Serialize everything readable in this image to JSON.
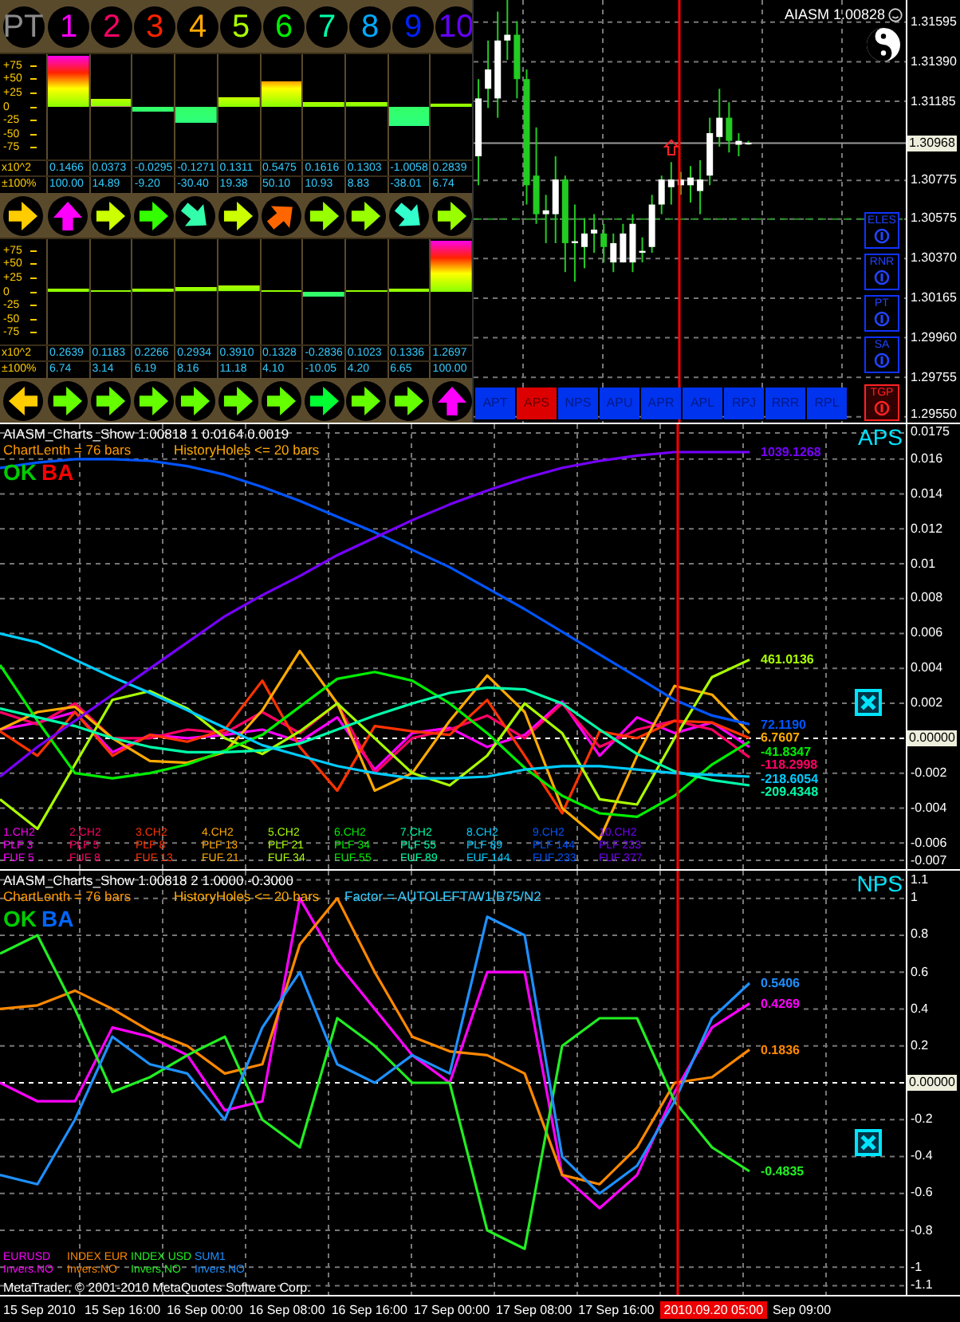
{
  "indicator_panel": {
    "header": [
      "PT",
      "1",
      "2",
      "3",
      "4",
      "5",
      "6",
      "7",
      "8",
      "9",
      "10"
    ],
    "blocks": [
      {
        "scale": [
          "+75",
          "+50",
          "+25",
          "0",
          "-25",
          "-50",
          "-75"
        ],
        "bars": [
          {
            "level": 1,
            "below_zero": false
          },
          {
            "level": 0.149,
            "below_zero": false
          },
          {
            "level": 0.092,
            "below_zero": true
          },
          {
            "level": 0.304,
            "below_zero": true
          },
          {
            "level": 0.194,
            "below_zero": false
          },
          {
            "level": 0.501,
            "below_zero": false
          },
          {
            "level": 0.109,
            "below_zero": false
          },
          {
            "level": 0.088,
            "below_zero": false
          },
          {
            "level": 0.38,
            "below_zero": true
          },
          {
            "level": 0.067,
            "below_zero": false
          }
        ],
        "value_row": {
          "label": "x10^2",
          "values": [
            "0.1466",
            "0.0373",
            "-0.0295",
            "-0.1271",
            "0.1311",
            "0.5475",
            "0.1616",
            "0.1303",
            "-1.0058",
            "0.2839"
          ]
        },
        "percent_row": {
          "label": "±100%",
          "values": [
            "100.00",
            "14.89",
            "-9.20",
            "-30.40",
            "19.38",
            "50.10",
            "10.93",
            "8.83",
            "-38.01",
            "6.74"
          ]
        },
        "arrows": [
          {
            "kind": "right",
            "color": "#ffcc00"
          },
          {
            "kind": "up",
            "color": "#ff00ff"
          },
          {
            "kind": "right",
            "color": "#ccff00"
          },
          {
            "kind": "right",
            "color": "#33ff00"
          },
          {
            "kind": "downright",
            "color": "#33ffaa"
          },
          {
            "kind": "right",
            "color": "#ccff00"
          },
          {
            "kind": "upright",
            "color": "#ff6600"
          },
          {
            "kind": "right",
            "color": "#99ff00"
          },
          {
            "kind": "right",
            "color": "#99ff00"
          },
          {
            "kind": "downright",
            "color": "#33ffcc"
          },
          {
            "kind": "right",
            "color": "#99ff00"
          }
        ]
      },
      {
        "scale": [
          "+75",
          "+50",
          "+25",
          "0",
          "-25",
          "-50",
          "-75"
        ],
        "bars": [
          {
            "level": 0.067,
            "below_zero": false
          },
          {
            "level": 0.031,
            "below_zero": false
          },
          {
            "level": 0.062,
            "below_zero": false
          },
          {
            "level": 0.082,
            "below_zero": false
          },
          {
            "level": 0.112,
            "below_zero": false
          },
          {
            "level": 0.041,
            "below_zero": false
          },
          {
            "level": 0.1,
            "below_zero": true
          },
          {
            "level": 0.042,
            "below_zero": false
          },
          {
            "level": 0.067,
            "below_zero": false
          },
          {
            "level": 1,
            "below_zero": false
          }
        ],
        "value_row": {
          "label": "x10^2",
          "values": [
            "0.2639",
            "0.1183",
            "0.2266",
            "0.2934",
            "0.3910",
            "0.1328",
            "-0.2836",
            "0.1023",
            "0.1336",
            "1.2697"
          ]
        },
        "percent_row": {
          "label": "±100%",
          "values": [
            "6.74",
            "3.14",
            "6.19",
            "8.16",
            "11.18",
            "4.10",
            "-10.05",
            "4.20",
            "6.65",
            "100.00"
          ]
        },
        "arrows": [
          {
            "kind": "left",
            "color": "#ffcc00"
          },
          {
            "kind": "right",
            "color": "#66ff00"
          },
          {
            "kind": "right",
            "color": "#66ff00"
          },
          {
            "kind": "right",
            "color": "#66ff00"
          },
          {
            "kind": "right",
            "color": "#66ff00"
          },
          {
            "kind": "right",
            "color": "#66ff00"
          },
          {
            "kind": "right",
            "color": "#66ff00"
          },
          {
            "kind": "right",
            "color": "#00ff33"
          },
          {
            "kind": "right",
            "color": "#66ff00"
          },
          {
            "kind": "right",
            "color": "#66ff00"
          },
          {
            "kind": "up",
            "color": "#ff00ff"
          }
        ]
      }
    ]
  },
  "price_chart": {
    "title": "AIASM 1.00828",
    "chart_data": {
      "type": "candlestick",
      "categories": [
        null,
        null,
        null,
        null,
        null,
        null,
        null,
        null,
        null,
        null,
        null,
        null,
        null,
        null,
        null,
        null,
        null,
        null,
        null,
        null,
        null,
        null,
        null,
        null,
        null,
        null,
        null,
        null,
        null,
        null,
        null,
        null,
        null,
        null,
        null,
        null,
        null,
        null,
        null,
        null,
        null,
        null,
        null,
        null,
        null
      ],
      "ylim": [
        1.2952,
        1.3171
      ],
      "yticks": [
        1.31595,
        {
          "value": 1.3139,
          "label": "1.31390"
        },
        1.31185,
        1.30775,
        1.30575,
        {
          "value": 1.3037,
          "label": "1.30370"
        },
        1.30165,
        {
          "value": 1.2996,
          "label": "1.29960"
        },
        1.29755,
        {
          "value": 1.2955,
          "label": "1.29550"
        }
      ],
      "ohlc": [
        [
          1.309,
          1.313,
          1.3075,
          1.312
        ],
        [
          1.3125,
          1.315,
          1.3115,
          1.3135
        ],
        [
          1.312,
          1.3165,
          1.311,
          1.315
        ],
        [
          1.315,
          1.3175,
          1.314,
          1.3153
        ],
        [
          1.3153,
          1.316,
          1.312,
          1.313
        ],
        [
          1.313,
          1.3135,
          1.3065,
          1.3075
        ],
        [
          1.308,
          1.3105,
          1.3055,
          1.306
        ],
        [
          1.306,
          1.307,
          1.3045,
          1.3062
        ],
        [
          1.306,
          1.309,
          1.3045,
          1.3078
        ],
        [
          1.3078,
          1.308,
          1.303,
          1.3045
        ],
        [
          1.3045,
          1.3065,
          1.3025,
          1.3046
        ],
        [
          1.3043,
          1.3058,
          1.3032,
          1.305
        ],
        [
          1.305,
          1.306,
          1.304,
          1.3052
        ],
        [
          1.305,
          1.3055,
          1.3035,
          1.3043
        ],
        [
          1.3035,
          1.305,
          1.303,
          1.3045
        ],
        [
          1.3035,
          1.3055,
          1.3035,
          1.305
        ],
        [
          1.3035,
          1.306,
          1.303,
          1.3055
        ],
        [
          1.304,
          1.3048,
          1.3035,
          1.3041
        ],
        [
          1.3043,
          1.307,
          1.304,
          1.3065
        ],
        [
          1.3065,
          1.308,
          1.306,
          1.3078
        ],
        [
          1.3074,
          1.3087,
          1.3065,
          1.3078
        ],
        [
          1.3075,
          1.3082,
          1.307,
          1.3078
        ],
        [
          1.3075,
          1.3085,
          1.3066,
          1.3079
        ],
        [
          1.3072,
          1.3088,
          1.306,
          1.3078
        ],
        [
          1.308,
          1.311,
          1.3075,
          1.3102
        ],
        [
          1.31,
          1.3125,
          1.3095,
          1.311
        ],
        [
          1.311,
          1.3118,
          1.3092,
          1.3098
        ],
        [
          1.3096,
          1.3102,
          1.309,
          1.3098
        ],
        [
          1.3097,
          1.3098,
          1.3096,
          1.3097
        ],
        null,
        null,
        null,
        null,
        null,
        null,
        null,
        null,
        null,
        null,
        null,
        null,
        null,
        null,
        null,
        null
      ],
      "ref_lines": [
        {
          "axis": "y",
          "value": 1.30968,
          "label": "1.30968"
        },
        {
          "axis": "y",
          "value": 1.30575
        }
      ],
      "grid": true
    },
    "side_toggles": [
      {
        "label": "ELES",
        "on": false
      },
      {
        "label": "RNR",
        "on": false
      },
      {
        "label": "PT",
        "on": false
      },
      {
        "label": "SA",
        "on": false
      }
    ],
    "buttons": [
      {
        "label": "APT",
        "selected": false
      },
      {
        "label": "APS",
        "selected": true
      },
      {
        "label": "NPS",
        "selected": false
      },
      {
        "label": "APU",
        "selected": false
      },
      {
        "label": "APR",
        "selected": false
      },
      {
        "label": "APL",
        "selected": false
      },
      {
        "label": "RPJ",
        "selected": false
      },
      {
        "label": "RRR",
        "selected": false
      },
      {
        "label": "RPL",
        "selected": false
      }
    ],
    "tgp": {
      "label": "TGP",
      "on": true
    }
  },
  "aps_panel": {
    "header": "AIASM_Charts_Show 1.00818 1 0.0164 0.0019",
    "info": [
      "ChartLenth = 76 bars",
      "HistoryHoles <= 20 bars"
    ],
    "status": [
      {
        "text": "OK",
        "color": "#00cc00"
      },
      {
        "text": "BA",
        "color": "#ff0000"
      }
    ],
    "name": "APS",
    "end_labels": [
      {
        "text": "1039.1268",
        "color": "#7700ff"
      },
      {
        "text": "461.0136",
        "color": "#aaff00"
      },
      {
        "text": "72.1190",
        "color": "#0055ff"
      },
      {
        "text": "6.7607",
        "color": "#ffaa00"
      },
      {
        "text": "-41.8347",
        "color": "#00ee00"
      },
      {
        "text": "-118.2998",
        "color": "#ff0066"
      },
      {
        "text": "-218.6054",
        "color": "#00ccff"
      },
      {
        "text": "-209.4348",
        "color": "#00ffaa"
      }
    ],
    "legend_notes": [
      [
        "PLF 3",
        "FUF 5"
      ],
      [
        "PLF 5",
        "FUF 8"
      ],
      [
        "PLF 8",
        "FUF 13"
      ],
      [
        "PLF 13",
        "FUF 21"
      ],
      [
        "PLF 21",
        "FUF 34"
      ],
      [
        "PLF 34",
        "FUF 55"
      ],
      [
        "PLF 55",
        "FUF 89"
      ],
      [
        "PLF 89",
        "FUF 144"
      ],
      [
        "PLF 144",
        "FUF 233"
      ],
      [
        "PLF 233",
        "FUF 377"
      ]
    ],
    "chart_data": {
      "type": "line",
      "categories": [
        null,
        null,
        null,
        null,
        null,
        null,
        null,
        null,
        null,
        null,
        null,
        null,
        null,
        null,
        null,
        null,
        null,
        null,
        null,
        null,
        null
      ],
      "ylim": [
        -0.0075,
        0.018
      ],
      "ref_lines": [
        {
          "axis": "y",
          "value": 0,
          "label": "0.00000"
        }
      ],
      "grid": true,
      "yticks": [
        0.0175,
        0.016,
        0.014,
        0.012,
        0.01,
        0.008,
        0.006,
        0.004,
        0.002,
        -0.002,
        -0.004,
        -0.006,
        -0.007
      ],
      "series": [
        {
          "name": "1.CH2",
          "color": "#ff00ff",
          "values": [
            0.0005,
            0.0009,
            0.0015,
            -0.0008,
            0.0002,
            0,
            0.0002,
            0.0005,
            -0.0002,
            0.0012,
            -0.0018,
            0.0003,
            0.0006,
            -0.0005,
            0.0002,
            0.0021,
            -0.001,
            0.0012,
            0.0003,
            0.0009,
            -0.0005
          ]
        },
        {
          "name": "2.CH2",
          "color": "#ff0066",
          "values": [
            0.0015,
            0.0008,
            0.002,
            0,
            0,
            0.0005,
            0.0003,
            0.0015,
            0.0003,
            0.002,
            -0.002,
            0,
            0.0005,
            0.0013,
            0,
            0.002,
            -0.0005,
            0.0005,
            0.001,
            0.0005,
            -0.0011
          ]
        },
        {
          "name": "3.CH2",
          "color": "#ff3300",
          "values": [
            0.0004,
            -0.001,
            0.0015,
            -0.001,
            0.0002,
            -0.0002,
            0.0005,
            0.0033,
            -0.0005,
            -0.003,
            0.0007,
            0.0004,
            0.0002,
            0.0022,
            -0.001,
            -0.0043,
            0.0004,
            0,
            0.001,
            0.0009,
            0
          ]
        },
        {
          "name": "4.CH2",
          "color": "#ffaa00",
          "values": [
            0.0005,
            0.0015,
            0.0018,
            0,
            -0.0013,
            -0.0014,
            -0.0008,
            0.0016,
            0.005,
            0.002,
            -0.003,
            -0.002,
            0.001,
            0.0036,
            0.0015,
            -0.004,
            -0.0058,
            -0.001,
            0.003,
            0.0025,
            0.0003
          ]
        },
        {
          "name": "5.CH2",
          "color": "#aaff00",
          "values": [
            -0.0035,
            -0.0052,
            -0.0015,
            0.0022,
            0.0027,
            0.0017,
            0,
            -0.0009,
            0.0004,
            0.002,
            0,
            -0.002,
            -0.0027,
            -0.001,
            0.002,
            0.0003,
            -0.0035,
            -0.0038,
            0,
            0.0035,
            0.0045
          ]
        },
        {
          "name": "6.CH2",
          "color": "#00ee00",
          "values": [
            0.0042,
            0.001,
            -0.002,
            -0.0023,
            -0.002,
            -0.0015,
            -0.0007,
            0.0002,
            0.0018,
            0.0034,
            0.0038,
            0.0033,
            0.002,
            0.0003,
            -0.0017,
            -0.0033,
            -0.0043,
            -0.0045,
            -0.0033,
            -0.0015,
            -0.0002
          ]
        },
        {
          "name": "7.CH2",
          "color": "#00ffaa",
          "values": [
            0.0017,
            0.0012,
            0.0007,
            0,
            -0.0005,
            -0.0008,
            -0.0008,
            -0.0007,
            -0.0003,
            0.0005,
            0.0013,
            0.002,
            0.0026,
            0.0029,
            0.0028,
            0.002,
            0.0005,
            -0.0009,
            -0.0019,
            -0.0024,
            -0.0027
          ]
        },
        {
          "name": "8.CH2",
          "color": "#00ccff",
          "values": [
            0.006,
            0.0055,
            0.0045,
            0.0035,
            0.0026,
            0.0016,
            0.0006,
            -0.0004,
            -0.001,
            -0.0016,
            -0.002,
            -0.0023,
            -0.0023,
            -0.0022,
            -0.0018,
            -0.0016,
            -0.0016,
            -0.0018,
            -0.002,
            -0.0021,
            -0.0022
          ]
        },
        {
          "name": "9.CH2",
          "color": "#0055ff",
          "values": [
            0.0155,
            0.0158,
            0.016,
            0.016,
            0.0159,
            0.0156,
            0.0151,
            0.0144,
            0.0136,
            0.0127,
            0.0118,
            0.0108,
            0.0098,
            0.0086,
            0.0074,
            0.0061,
            0.0048,
            0.0035,
            0.0022,
            0.0013,
            0.0008
          ]
        },
        {
          "name": "10.CH2",
          "color": "#7700ff",
          "values": [
            -0.0022,
            -0.0005,
            0.001,
            0.0025,
            0.004,
            0.0055,
            0.007,
            0.0082,
            0.0093,
            0.0105,
            0.0115,
            0.0125,
            0.0134,
            0.0142,
            0.0149,
            0.0155,
            0.0159,
            0.0162,
            0.0164,
            0.0164,
            0.0164
          ]
        }
      ]
    }
  },
  "nps_panel": {
    "header": "AIASM_Charts_Show 1.00818 2 1.0000 -0.3000",
    "info": [
      "ChartLenth = 76 bars",
      "HistoryHoles <= 20 bars",
      "Factor = AUTOLEFT/W1/B75/N2"
    ],
    "status": [
      {
        "text": "OK",
        "color": "#00cc00"
      },
      {
        "text": "BA",
        "color": "#0066ff"
      }
    ],
    "name": "NPS",
    "end_labels": [
      {
        "text": "0.5406",
        "color": "#1e90ff"
      },
      {
        "text": "0.4269",
        "color": "#ff00ff"
      },
      {
        "text": "0.1836",
        "color": "#ff8800"
      },
      {
        "text": "-0.4835",
        "color": "#22ee22"
      }
    ],
    "legend_notes": [
      [
        "Invers.NO"
      ],
      [
        "Invers.NO"
      ],
      [
        "Invers.NO"
      ],
      [
        "Invers.NO"
      ]
    ],
    "chart_data": {
      "type": "line",
      "categories": [
        null,
        null,
        null,
        null,
        null,
        null,
        null,
        null,
        null,
        null,
        null,
        null,
        null,
        null,
        null,
        null,
        null,
        null,
        null,
        null,
        null
      ],
      "ylim": [
        -1.15,
        1.15
      ],
      "ref_lines": [
        {
          "axis": "y",
          "value": 0,
          "label": "0.00000"
        }
      ],
      "grid": true,
      "yticks": [
        1.1,
        1,
        0.8,
        0.6,
        0.4,
        0.2,
        -0.2,
        -0.4,
        -0.6,
        -0.8,
        -1,
        -1.1
      ],
      "series": [
        {
          "name": "EURUSD",
          "color": "#ff00ff",
          "values": [
            0,
            -0.1,
            -0.1,
            0.3,
            0.25,
            0.15,
            -0.15,
            -0.1,
            1,
            0.65,
            0.4,
            0.15,
            0,
            0.6,
            0.6,
            -0.5,
            -0.68,
            -0.5,
            -0.05,
            0.3,
            0.43
          ]
        },
        {
          "name": "INDEX EUR",
          "color": "#ff8800",
          "values": [
            0.4,
            0.42,
            0.5,
            0.4,
            0.28,
            0.2,
            0.05,
            0.1,
            0.75,
            1,
            0.6,
            0.25,
            0.17,
            0.15,
            0.05,
            -0.5,
            -0.55,
            -0.35,
            0,
            0.03,
            0.18
          ]
        },
        {
          "name": "INDEX USD",
          "color": "#22ee22",
          "values": [
            0.7,
            0.8,
            0.4,
            -0.05,
            0.03,
            0.15,
            0.25,
            -0.2,
            -0.35,
            0.35,
            0.2,
            0,
            0,
            -0.8,
            -0.9,
            0.2,
            0.35,
            0.35,
            -0.1,
            -0.35,
            -0.48
          ]
        },
        {
          "name": "SUM1",
          "color": "#1e90ff",
          "values": [
            -0.5,
            -0.55,
            -0.2,
            0.25,
            0.1,
            0.05,
            -0.2,
            0.3,
            0.6,
            0.1,
            0,
            0.15,
            0.05,
            0.9,
            0.8,
            -0.4,
            -0.6,
            -0.45,
            -0.1,
            0.35,
            0.54
          ]
        }
      ]
    },
    "copyright": "MetaTrader, © 2001-2010 MetaQuotes Software Corp."
  },
  "time_axis": [
    {
      "text": "15 Sep 2010",
      "highlighted": false
    },
    {
      "text": "15 Sep 16:00",
      "highlighted": false
    },
    {
      "text": "16 Sep 00:00",
      "highlighted": false
    },
    {
      "text": "16 Sep 08:00",
      "highlighted": false
    },
    {
      "text": "16 Sep 16:00",
      "highlighted": false
    },
    {
      "text": "17 Sep 00:00",
      "highlighted": false
    },
    {
      "text": "17 Sep 08:00",
      "highlighted": false
    },
    {
      "text": "17 Sep 16:00",
      "highlighted": false
    },
    {
      "text": "2010.09.20 05:00",
      "highlighted": true
    },
    {
      "text": "Sep 09:00",
      "highlighted": false
    }
  ]
}
